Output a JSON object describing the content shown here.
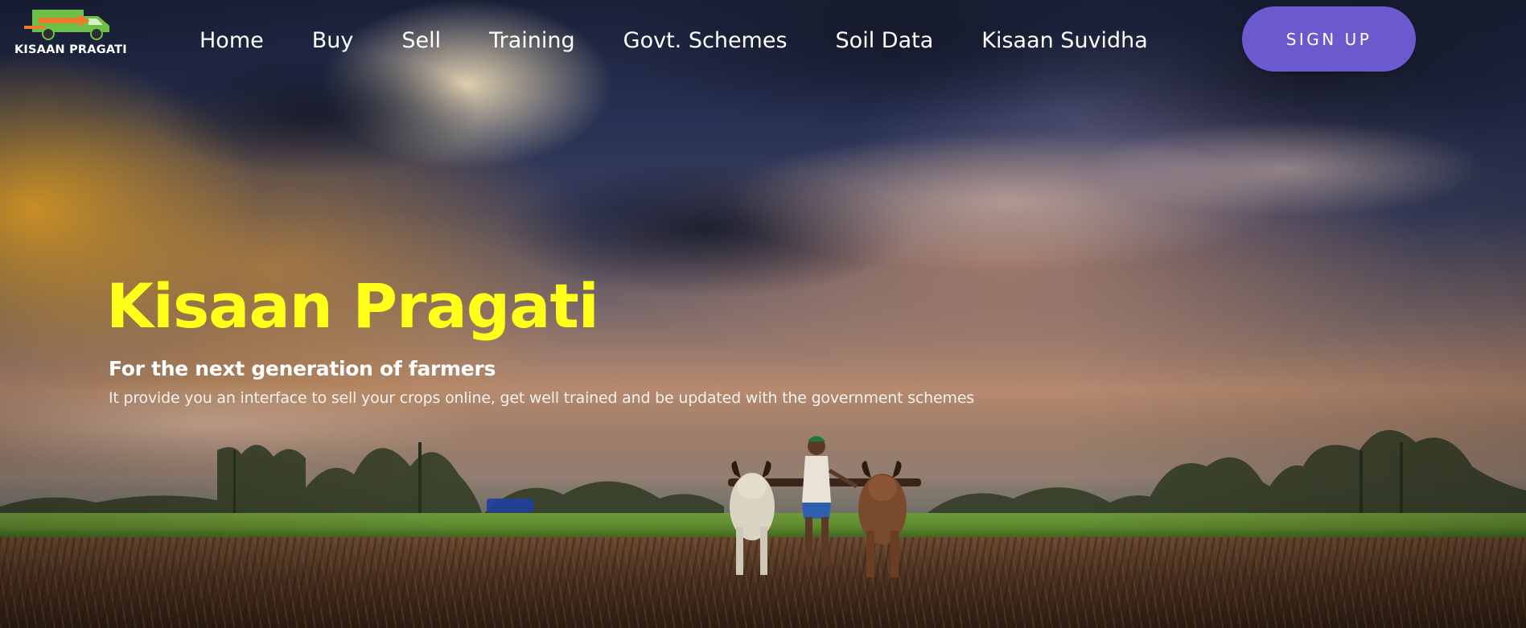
{
  "brand": {
    "name": "KISAAN PRAGATI",
    "logo_icon": "delivery-truck-icon",
    "colors": {
      "truck": "#6cc04a",
      "arrow": "#f07a2a"
    }
  },
  "nav": {
    "items": [
      {
        "label": "Home"
      },
      {
        "label": "Buy"
      },
      {
        "label": "Sell"
      },
      {
        "label": "Training"
      },
      {
        "label": "Govt. Schemes"
      },
      {
        "label": "Soil Data"
      },
      {
        "label": "Kisaan Suvidha"
      }
    ],
    "signup_label": "SIGN UP"
  },
  "hero": {
    "title": "Kisaan Pragati",
    "subtitle": "For the next generation of farmers",
    "description": "It provide you an interface to sell your crops online, get well trained and be updated with the government schemes"
  },
  "colors": {
    "accent": "#6a5acd",
    "title": "#ffff1a",
    "text": "#ffffff"
  }
}
